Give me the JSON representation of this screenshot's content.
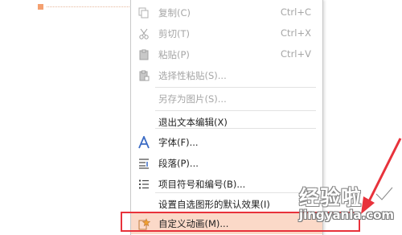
{
  "menu": {
    "copy": {
      "label": "复制(C)",
      "shortcut": "Ctrl+C",
      "icon": "copy-icon"
    },
    "cut": {
      "label": "剪切(T)",
      "shortcut": "Ctrl+X",
      "icon": "scissors-icon"
    },
    "paste": {
      "label": "粘贴(P)",
      "shortcut": "Ctrl+V",
      "icon": "paste-icon"
    },
    "paste_special": {
      "label": "选择性粘贴(S)...",
      "icon": "paste-special-icon"
    },
    "save_as_picture": {
      "label": "另存为图片(S)..."
    },
    "exit_text_edit": {
      "label": "退出文本编辑(X)"
    },
    "font": {
      "label": "字体(F)...",
      "icon": "font-icon"
    },
    "paragraph": {
      "label": "段落(P)...",
      "icon": "paragraph-icon"
    },
    "bullets": {
      "label": "项目符号和编号(B)...",
      "icon": "bullet-list-icon"
    },
    "set_default": {
      "label": "设置自选图形的默认效果(I)"
    },
    "custom_animation": {
      "label": "自定义动画(M)...",
      "icon": "animation-star-icon"
    }
  },
  "colors": {
    "highlight": "#fbd9c8",
    "annotation_red": "#e8323b",
    "disabled_text": "#a6a6a6"
  },
  "watermark": {
    "cn": "经验啦",
    "en": "jingyanla.com"
  }
}
